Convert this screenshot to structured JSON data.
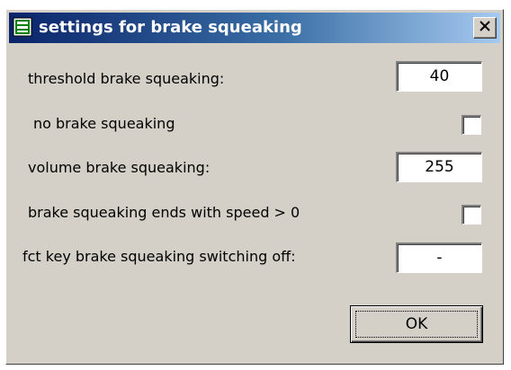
{
  "window": {
    "title": "settings for brake squeaking",
    "title_icon": "window-app-icon",
    "close_icon": "close-icon"
  },
  "fields": {
    "threshold": {
      "label": "threshold brake squeaking:",
      "value": "40"
    },
    "no_squeak": {
      "label": "no brake squeaking",
      "checked": false
    },
    "volume": {
      "label": "volume brake squeaking:",
      "value": "255"
    },
    "ends_with_speed": {
      "label": "brake squeaking ends with speed > 0",
      "checked": false
    },
    "fct_key": {
      "label": "fct key brake squeaking switching off:",
      "value": "-"
    }
  },
  "buttons": {
    "ok_label": "OK"
  },
  "colors": {
    "dialog_bg": "#d4d0c8",
    "title_gradient_start": "#0a246a",
    "title_gradient_end": "#a6caf0",
    "title_text": "#ffffff"
  }
}
